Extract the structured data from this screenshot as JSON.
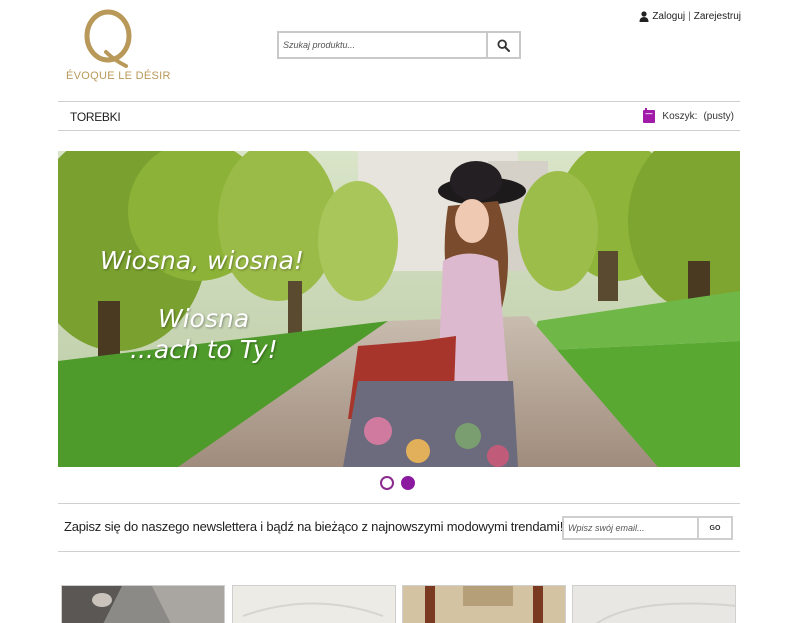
{
  "brand": {
    "logo_text": "ÉVOQUE LE DÉSIR",
    "logo_color": "#b8995a"
  },
  "search": {
    "placeholder": "Szukaj produktu..."
  },
  "user": {
    "login_label": "Zaloguj",
    "separator": "|",
    "register_label": "Zarejestruj"
  },
  "nav": {
    "items": [
      {
        "label": "TOREBKI"
      }
    ]
  },
  "cart": {
    "label": "Koszyk:",
    "status": "(pusty)",
    "icon_color": "#a11aa8"
  },
  "banner": {
    "lines": [
      "Wiosna, wiosna!",
      "Wiosna",
      "...ach to Ty!"
    ],
    "slide_count": 2,
    "active_slide": 2
  },
  "newsletter": {
    "text": "Zapisz się do naszego newslettera i bądź na bieżąco z najnowszymi modowymi trendami!",
    "placeholder": "Wpisz swój email...",
    "button_label": "GO"
  },
  "colors": {
    "accent": "#8b1aa0",
    "border": "#cfcfcf"
  }
}
